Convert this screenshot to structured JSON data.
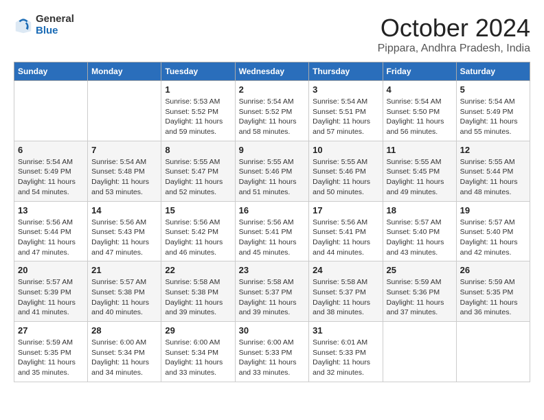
{
  "logo": {
    "general": "General",
    "blue": "Blue"
  },
  "header": {
    "month": "October 2024",
    "location": "Pippara, Andhra Pradesh, India"
  },
  "days_of_week": [
    "Sunday",
    "Monday",
    "Tuesday",
    "Wednesday",
    "Thursday",
    "Friday",
    "Saturday"
  ],
  "weeks": [
    [
      {
        "day": "",
        "info": ""
      },
      {
        "day": "",
        "info": ""
      },
      {
        "day": "1",
        "sunrise": "5:53 AM",
        "sunset": "5:52 PM",
        "daylight": "11 hours and 59 minutes."
      },
      {
        "day": "2",
        "sunrise": "5:54 AM",
        "sunset": "5:52 PM",
        "daylight": "11 hours and 58 minutes."
      },
      {
        "day": "3",
        "sunrise": "5:54 AM",
        "sunset": "5:51 PM",
        "daylight": "11 hours and 57 minutes."
      },
      {
        "day": "4",
        "sunrise": "5:54 AM",
        "sunset": "5:50 PM",
        "daylight": "11 hours and 56 minutes."
      },
      {
        "day": "5",
        "sunrise": "5:54 AM",
        "sunset": "5:49 PM",
        "daylight": "11 hours and 55 minutes."
      }
    ],
    [
      {
        "day": "6",
        "sunrise": "5:54 AM",
        "sunset": "5:49 PM",
        "daylight": "11 hours and 54 minutes."
      },
      {
        "day": "7",
        "sunrise": "5:54 AM",
        "sunset": "5:48 PM",
        "daylight": "11 hours and 53 minutes."
      },
      {
        "day": "8",
        "sunrise": "5:55 AM",
        "sunset": "5:47 PM",
        "daylight": "11 hours and 52 minutes."
      },
      {
        "day": "9",
        "sunrise": "5:55 AM",
        "sunset": "5:46 PM",
        "daylight": "11 hours and 51 minutes."
      },
      {
        "day": "10",
        "sunrise": "5:55 AM",
        "sunset": "5:46 PM",
        "daylight": "11 hours and 50 minutes."
      },
      {
        "day": "11",
        "sunrise": "5:55 AM",
        "sunset": "5:45 PM",
        "daylight": "11 hours and 49 minutes."
      },
      {
        "day": "12",
        "sunrise": "5:55 AM",
        "sunset": "5:44 PM",
        "daylight": "11 hours and 48 minutes."
      }
    ],
    [
      {
        "day": "13",
        "sunrise": "5:56 AM",
        "sunset": "5:44 PM",
        "daylight": "11 hours and 47 minutes."
      },
      {
        "day": "14",
        "sunrise": "5:56 AM",
        "sunset": "5:43 PM",
        "daylight": "11 hours and 47 minutes."
      },
      {
        "day": "15",
        "sunrise": "5:56 AM",
        "sunset": "5:42 PM",
        "daylight": "11 hours and 46 minutes."
      },
      {
        "day": "16",
        "sunrise": "5:56 AM",
        "sunset": "5:41 PM",
        "daylight": "11 hours and 45 minutes."
      },
      {
        "day": "17",
        "sunrise": "5:56 AM",
        "sunset": "5:41 PM",
        "daylight": "11 hours and 44 minutes."
      },
      {
        "day": "18",
        "sunrise": "5:57 AM",
        "sunset": "5:40 PM",
        "daylight": "11 hours and 43 minutes."
      },
      {
        "day": "19",
        "sunrise": "5:57 AM",
        "sunset": "5:40 PM",
        "daylight": "11 hours and 42 minutes."
      }
    ],
    [
      {
        "day": "20",
        "sunrise": "5:57 AM",
        "sunset": "5:39 PM",
        "daylight": "11 hours and 41 minutes."
      },
      {
        "day": "21",
        "sunrise": "5:57 AM",
        "sunset": "5:38 PM",
        "daylight": "11 hours and 40 minutes."
      },
      {
        "day": "22",
        "sunrise": "5:58 AM",
        "sunset": "5:38 PM",
        "daylight": "11 hours and 39 minutes."
      },
      {
        "day": "23",
        "sunrise": "5:58 AM",
        "sunset": "5:37 PM",
        "daylight": "11 hours and 39 minutes."
      },
      {
        "day": "24",
        "sunrise": "5:58 AM",
        "sunset": "5:37 PM",
        "daylight": "11 hours and 38 minutes."
      },
      {
        "day": "25",
        "sunrise": "5:59 AM",
        "sunset": "5:36 PM",
        "daylight": "11 hours and 37 minutes."
      },
      {
        "day": "26",
        "sunrise": "5:59 AM",
        "sunset": "5:35 PM",
        "daylight": "11 hours and 36 minutes."
      }
    ],
    [
      {
        "day": "27",
        "sunrise": "5:59 AM",
        "sunset": "5:35 PM",
        "daylight": "11 hours and 35 minutes."
      },
      {
        "day": "28",
        "sunrise": "6:00 AM",
        "sunset": "5:34 PM",
        "daylight": "11 hours and 34 minutes."
      },
      {
        "day": "29",
        "sunrise": "6:00 AM",
        "sunset": "5:34 PM",
        "daylight": "11 hours and 33 minutes."
      },
      {
        "day": "30",
        "sunrise": "6:00 AM",
        "sunset": "5:33 PM",
        "daylight": "11 hours and 33 minutes."
      },
      {
        "day": "31",
        "sunrise": "6:01 AM",
        "sunset": "5:33 PM",
        "daylight": "11 hours and 32 minutes."
      },
      {
        "day": "",
        "info": ""
      },
      {
        "day": "",
        "info": ""
      }
    ]
  ],
  "labels": {
    "sunrise": "Sunrise:",
    "sunset": "Sunset:",
    "daylight": "Daylight:"
  }
}
